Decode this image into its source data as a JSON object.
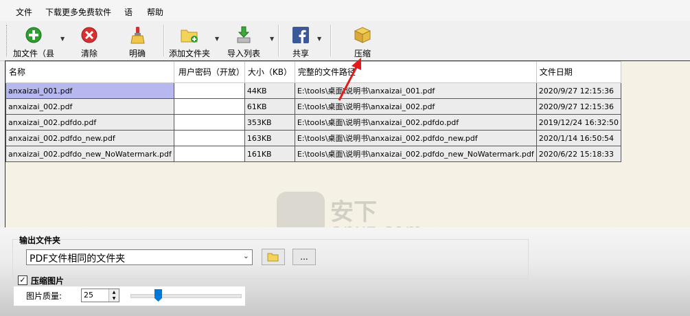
{
  "menu": [
    "文件",
    "下载更多免费软件",
    "语",
    "帮助"
  ],
  "toolbar": {
    "add_file": "加文件（县",
    "clear": "清除",
    "clarify": "明确",
    "add_folder": "添加文件夹",
    "import_list": "导入列表",
    "share": "共享",
    "compress": "压缩"
  },
  "table": {
    "headers": [
      "名称",
      "用户密码（开放）",
      "大小（KB）",
      "完整的文件路径",
      "文件日期"
    ],
    "rows": [
      {
        "name": "anxaizai_001.pdf",
        "password": "",
        "size": "44KB",
        "path": "E:\\tools\\桌面\\说明书\\anxaizai_001.pdf",
        "date": "2020/9/27 12:15:36"
      },
      {
        "name": "anxaizai_002.pdf",
        "password": "",
        "size": "61KB",
        "path": "E:\\tools\\桌面\\说明书\\anxaizai_002.pdf",
        "date": "2020/9/27 12:15:36"
      },
      {
        "name": "anxaizai_002.pdfdo.pdf",
        "password": "",
        "size": "353KB",
        "path": "E:\\tools\\桌面\\说明书\\anxaizai_002.pdfdo.pdf",
        "date": "2019/12/24 16:32:50"
      },
      {
        "name": "anxaizai_002.pdfdo_new.pdf",
        "password": "",
        "size": "163KB",
        "path": "E:\\tools\\桌面\\说明书\\anxaizai_002.pdfdo_new.pdf",
        "date": "2020/1/14 16:50:54"
      },
      {
        "name": "anxaizai_002.pdfdo_new_NoWatermark.pdf",
        "password": "",
        "size": "161KB",
        "path": "E:\\tools\\桌面\\说明书\\anxaizai_002.pdfdo_new_NoWatermark.pdf",
        "date": "2020/6/22 15:18:33"
      }
    ]
  },
  "output": {
    "group_title": "输出文件夹",
    "folder_value": "PDF文件相同的文件夹",
    "browse_label": "..."
  },
  "compress_images": {
    "label": "压缩图片",
    "checked": true,
    "check_mark": "✓",
    "quality_label": "图片质量:",
    "quality_value": "25"
  },
  "watermark": {
    "cn": "安下",
    "text": "anxz.com"
  },
  "colors": {
    "accent": "#0078d7",
    "selection": "#b8b8f0",
    "grid_bg": "#f5f1e4"
  }
}
